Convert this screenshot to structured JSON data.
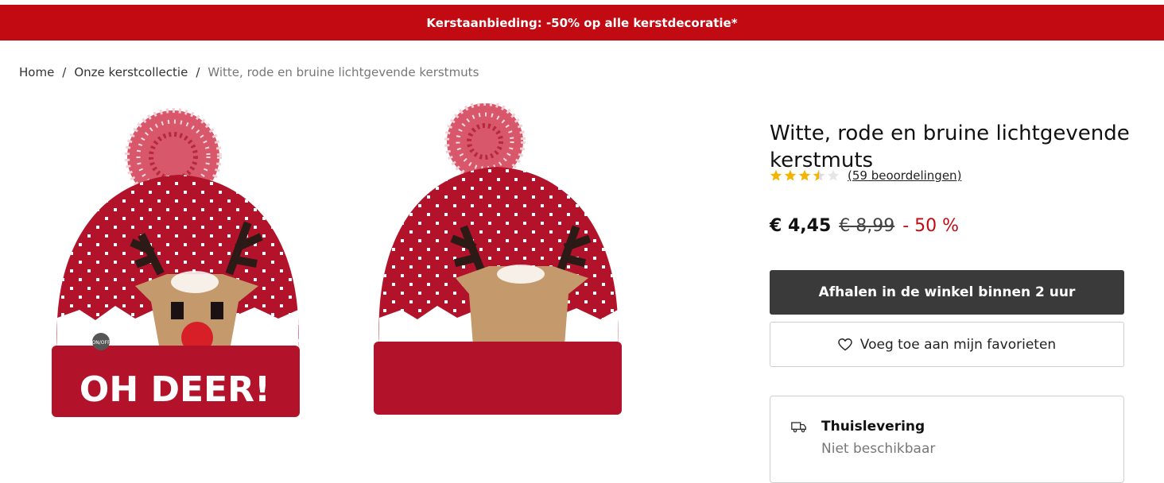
{
  "promo": {
    "text": "Kerstaanbieding: -50% op alle kerstdecoratie*"
  },
  "breadcrumb": {
    "items": [
      "Home",
      "Onze kerstcollectie",
      "Witte, rode en bruine lichtgevende kerstmuts"
    ],
    "separator": "/"
  },
  "product": {
    "title": "Witte, rode en bruine lichtgevende kerstmuts",
    "rating": {
      "value": 3.5,
      "max": 5,
      "reviews_label": "(59 beoordelingen)"
    },
    "price": {
      "current": "€ 4,45",
      "old": "€ 8,99",
      "discount": "- 50 %"
    },
    "images": [
      {
        "name": "product-image-front",
        "text": "OH DEER!",
        "badge": "ON/OFF"
      },
      {
        "name": "product-image-back"
      }
    ]
  },
  "actions": {
    "pickup_label": "Afhalen in de winkel binnen 2 uur",
    "favorite_label": "Voeg toe aan mijn favorieten"
  },
  "delivery": {
    "title": "Thuislevering",
    "status": "Niet beschikbaar"
  },
  "colors": {
    "brand_red": "#c20a12",
    "button_dark": "#3a3a3a",
    "star": "#f5b400",
    "star_empty": "#dcdcdc"
  }
}
